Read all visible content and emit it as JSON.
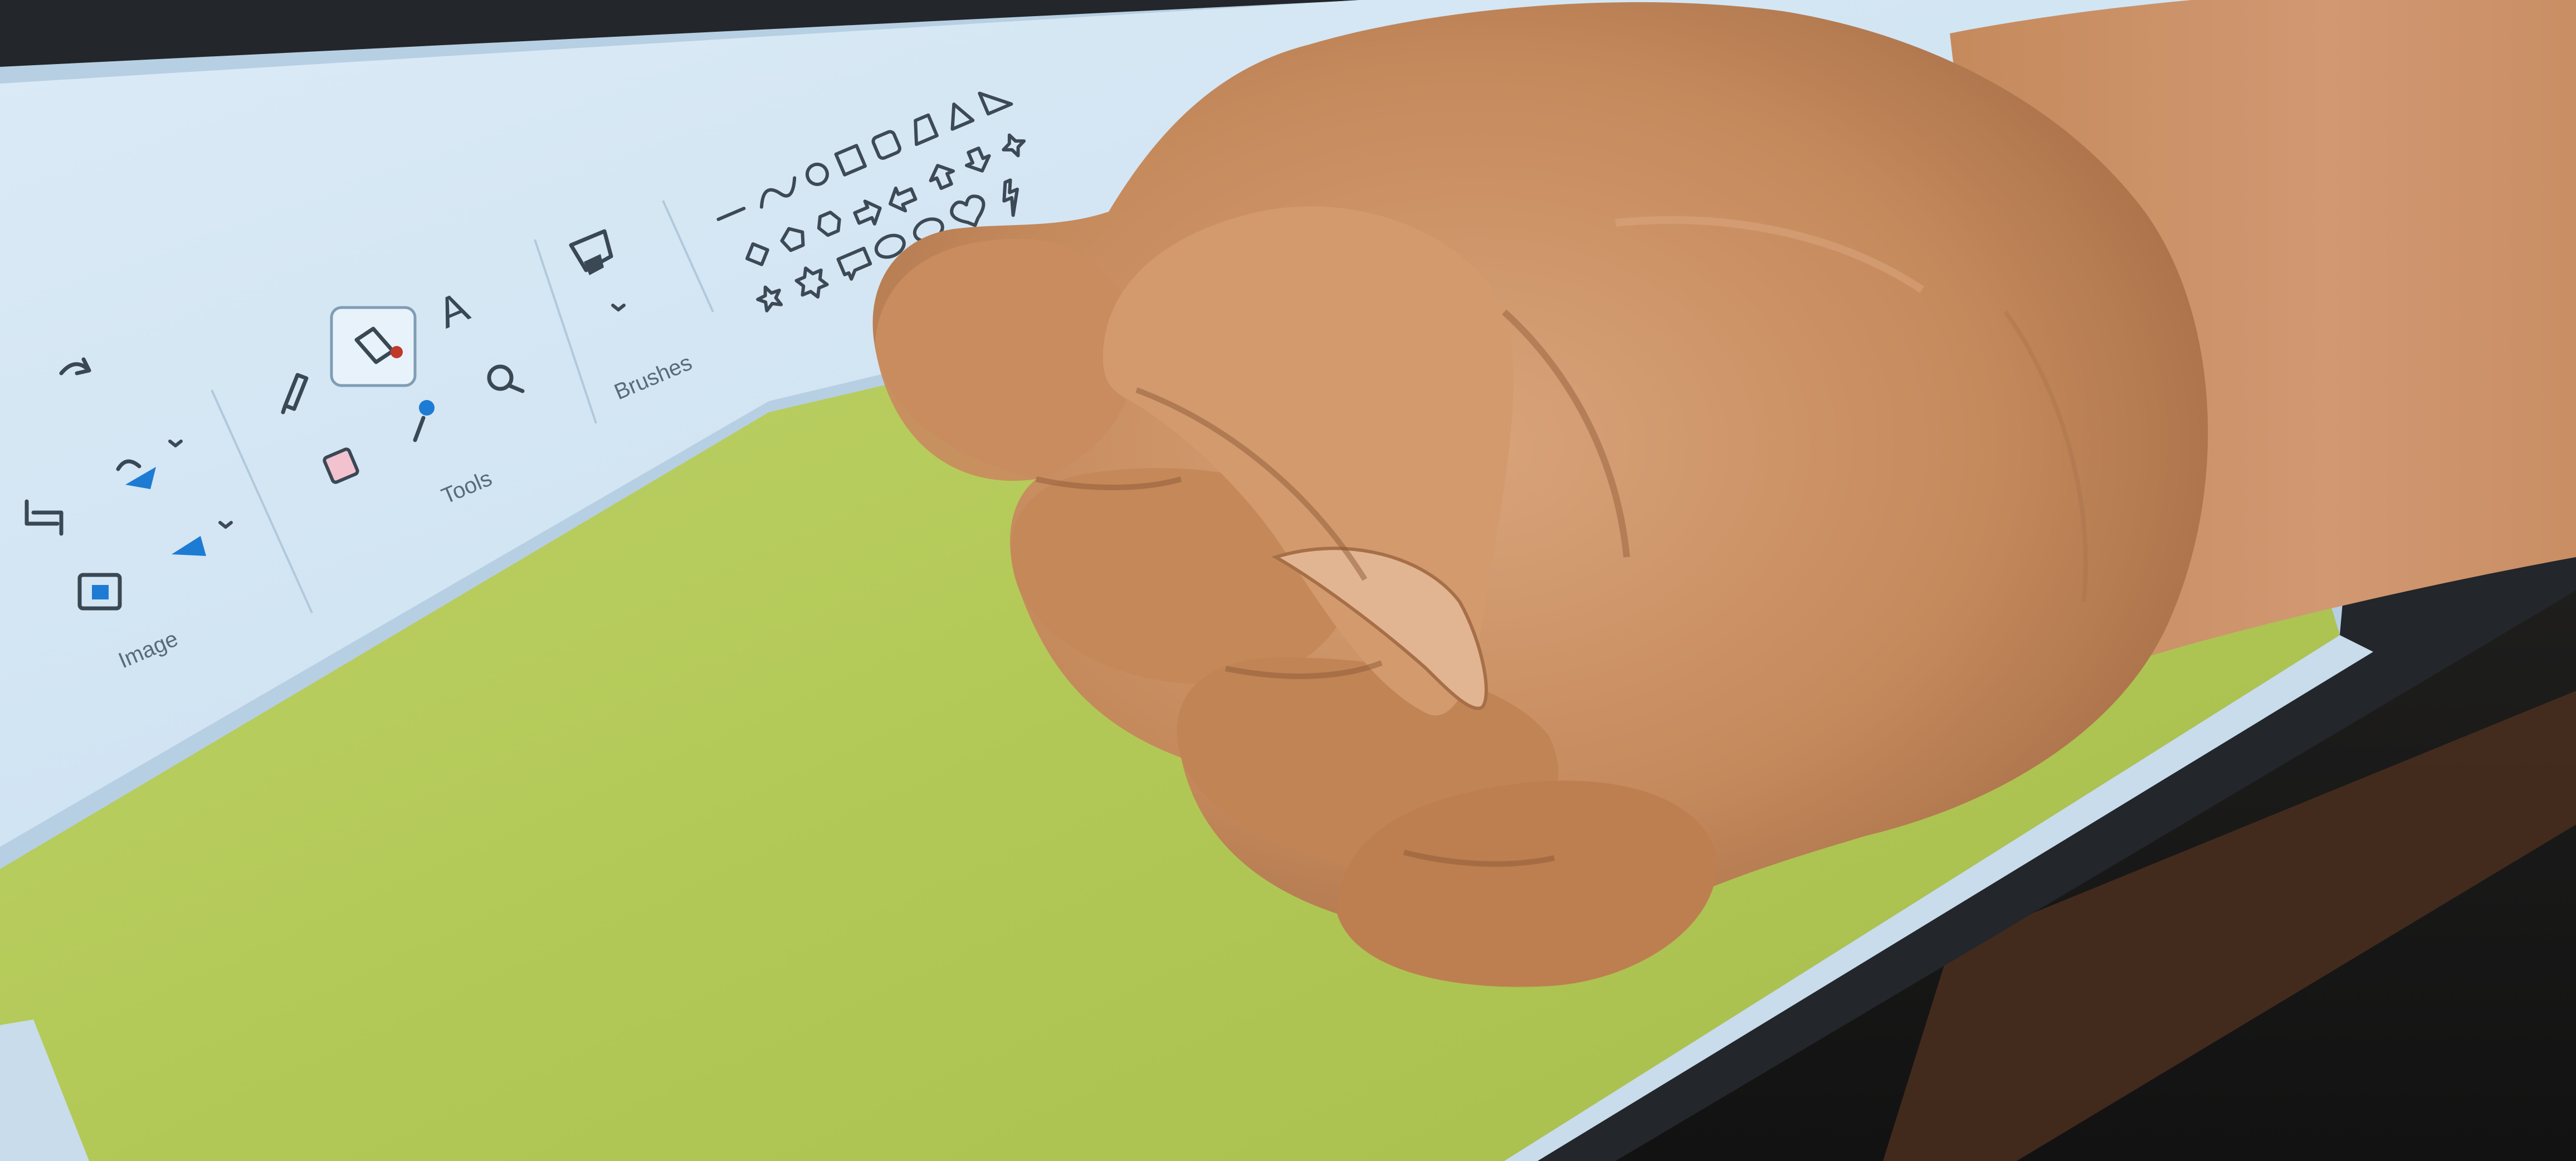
{
  "photo": {
    "subject": "",
    "colors": {
      "desk": "#1a1a1a",
      "screen_bezel": "#2a2d31",
      "ribbon": "#cfe3f2",
      "ribbon_edge": "#b9d3e8",
      "canvas": "#b6cb5a",
      "skin_mid": "#c58a5c",
      "skin_light": "#d9a37a",
      "skin_dark": "#9a6340",
      "accent_blue": "#1e7bd4"
    }
  },
  "ribbon": {
    "groups": [
      {
        "label": "Image"
      },
      {
        "label": "Tools"
      },
      {
        "label": "Brushes"
      }
    ],
    "tools": {
      "text_tool_glyph": "A"
    }
  }
}
